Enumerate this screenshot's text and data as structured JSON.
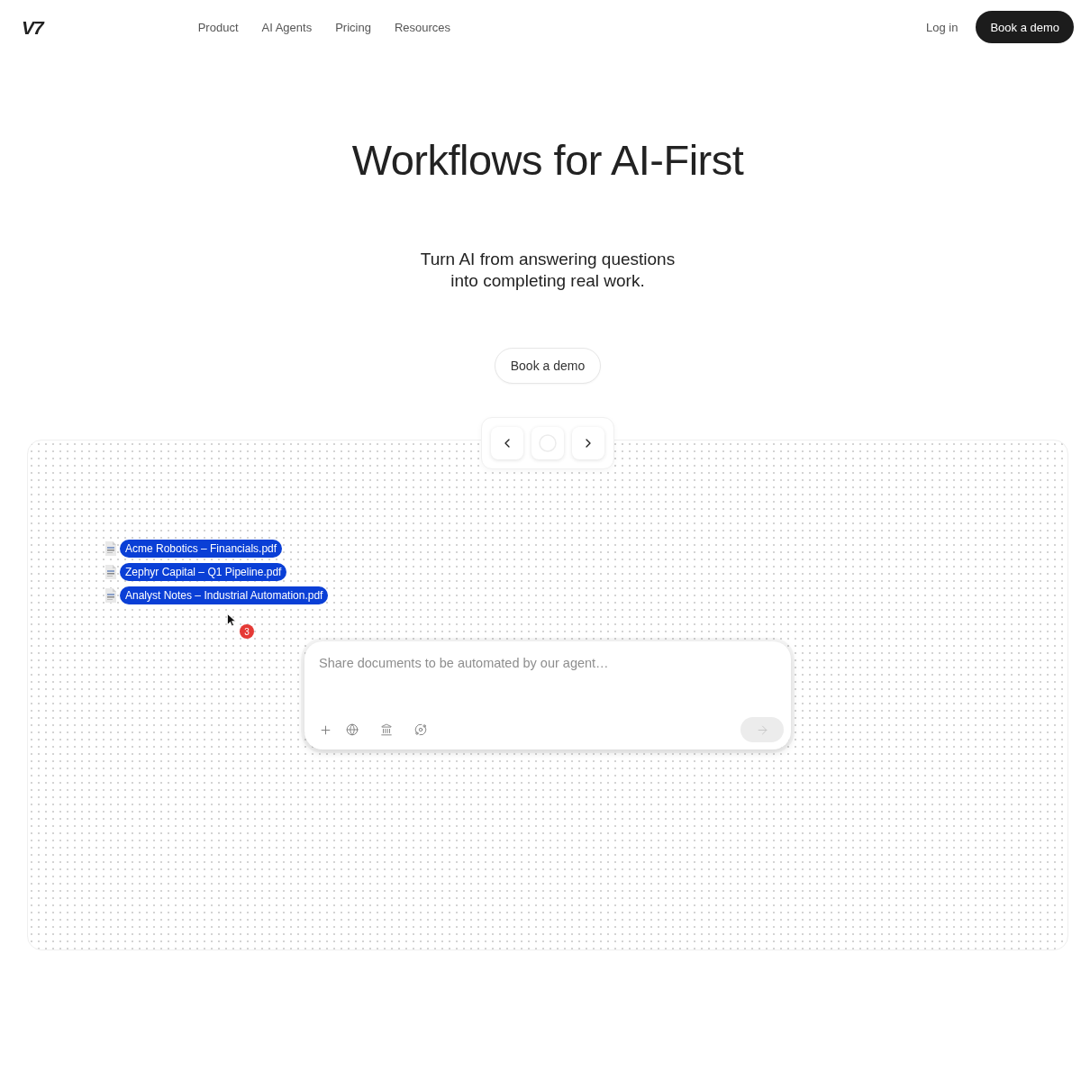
{
  "nav": {
    "logo": "V7",
    "links": [
      {
        "label": "Product"
      },
      {
        "label": "AI Agents"
      },
      {
        "label": "Pricing"
      },
      {
        "label": "Resources"
      }
    ],
    "login": "Log in",
    "cta": "Book a demo"
  },
  "hero": {
    "title": "Workflows for AI-First",
    "subtitle": "Turn AI from answering questions into completing real work.",
    "button": "Book a demo"
  },
  "canvas": {
    "files": [
      {
        "name": "Acme Robotics – Financials.pdf"
      },
      {
        "name": "Zephyr Capital – Q1 Pipeline.pdf"
      },
      {
        "name": "Analyst Notes – Industrial Automation.pdf"
      }
    ],
    "drag_count": "3",
    "composer": {
      "placeholder": "Share documents to be automated by our agent…",
      "send_disabled": true
    }
  }
}
